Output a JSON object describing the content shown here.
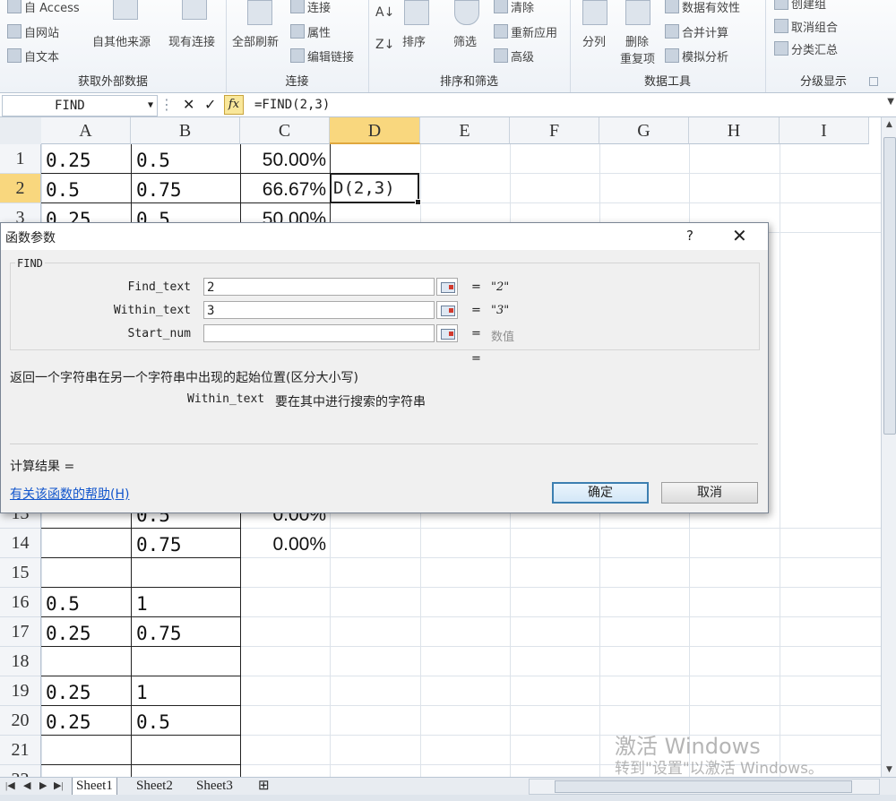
{
  "ribbon": {
    "groups": {
      "external": {
        "title": "获取外部数据",
        "from_access": "自 Access",
        "from_web": "自网站",
        "from_text": "自文本",
        "from_other": "自其他来源",
        "existing": "现有连接"
      },
      "connections": {
        "title": "连接",
        "refresh_all": "全部刷新",
        "connections": "连接",
        "properties": "属性",
        "edit_links": "编辑链接"
      },
      "sort_filter": {
        "title": "排序和筛选",
        "sort": "排序",
        "filter": "筛选",
        "clear": "清除",
        "reapply": "重新应用",
        "advanced": "高级"
      },
      "data_tools": {
        "title": "数据工具",
        "text_to_columns": "分列",
        "remove_dup_1": "删除",
        "remove_dup_2": "重复项",
        "validation": "数据有效性",
        "consolidate": "合并计算",
        "whatif": "模拟分析"
      },
      "outline": {
        "title": "分级显示",
        "group": "创建组",
        "ungroup": "取消组合",
        "subtotal": "分类汇总"
      }
    }
  },
  "formula_bar": {
    "name_box": "FIND",
    "formula": "=FIND(2,3)",
    "cancel_glyph": "✕",
    "enter_glyph": "✓",
    "fx_glyph": "fx"
  },
  "sheet": {
    "columns": [
      "A",
      "B",
      "C",
      "D",
      "E",
      "F",
      "G",
      "H",
      "I"
    ],
    "selected_column": "D",
    "active_cell_text": "D(2,3)",
    "rows": [
      {
        "row": "1",
        "a": "0.25",
        "b": "0.5",
        "c": "50.00%"
      },
      {
        "row": "2",
        "a": "0.5",
        "b": "0.75",
        "c": "66.67%"
      },
      {
        "row": "3",
        "a": "0.25",
        "b": "0.5",
        "c": "50.00%"
      },
      {
        "row": "13",
        "a": "",
        "b": "0.5",
        "c": "0.00%"
      },
      {
        "row": "14",
        "a": "",
        "b": "0.75",
        "c": "0.00%"
      },
      {
        "row": "15",
        "a": "",
        "b": "",
        "c": ""
      },
      {
        "row": "16",
        "a": "0.5",
        "b": "1",
        "c": ""
      },
      {
        "row": "17",
        "a": "0.25",
        "b": "0.75",
        "c": ""
      },
      {
        "row": "18",
        "a": "",
        "b": "",
        "c": ""
      },
      {
        "row": "19",
        "a": "0.25",
        "b": "1",
        "c": ""
      },
      {
        "row": "20",
        "a": "0.25",
        "b": "0.5",
        "c": ""
      },
      {
        "row": "21",
        "a": "",
        "b": "",
        "c": ""
      },
      {
        "row": "22",
        "a": "",
        "b": "",
        "c": ""
      }
    ]
  },
  "tabs": {
    "sheets": [
      "Sheet1",
      "Sheet2",
      "Sheet3"
    ],
    "active": "Sheet1"
  },
  "dialog": {
    "title": "函数参数",
    "help_glyph": "?",
    "close_glyph": "✕",
    "function_name": "FIND",
    "args": [
      {
        "label": "Find_text",
        "value": "2",
        "result": "\"2\""
      },
      {
        "label": "Within_text",
        "value": "3",
        "result": "\"3\""
      },
      {
        "label": "Start_num",
        "value": "",
        "result": "数值"
      }
    ],
    "equals": "=",
    "function_result": "",
    "description": "返回一个字符串在另一个字符串中出现的起始位置(区分大小写)",
    "arg_desc_name": "Within_text",
    "arg_desc_text": "要在其中进行搜索的字符串",
    "result_label": "计算结果 =",
    "help_link": "有关该函数的帮助(H)",
    "ok": "确定",
    "cancel": "取消"
  },
  "watermark": {
    "line1": "激活 Windows",
    "line2": "转到\"设置\"以激活 Windows。"
  },
  "colors": {
    "selected_header": "#f9d77e",
    "link": "#1155cc",
    "default_button_border": "#3c7fb1"
  }
}
